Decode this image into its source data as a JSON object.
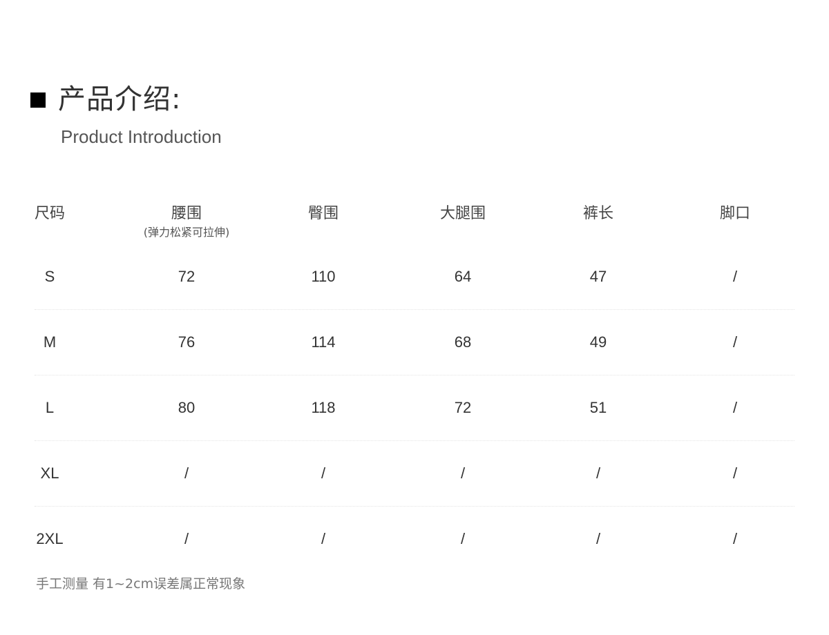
{
  "section": {
    "title": "产品介绍:",
    "subtitle": "Product Introduction"
  },
  "table": {
    "headers": [
      {
        "label": "尺码",
        "note": ""
      },
      {
        "label": "腰围",
        "note": "(弹力松紧可拉伸)"
      },
      {
        "label": "臀围",
        "note": ""
      },
      {
        "label": "大腿围",
        "note": ""
      },
      {
        "label": "裤长",
        "note": ""
      },
      {
        "label": "脚口",
        "note": ""
      }
    ],
    "rows": [
      [
        "S",
        "72",
        "110",
        "64",
        "47",
        "/"
      ],
      [
        "M",
        "76",
        "114",
        "68",
        "49",
        "/"
      ],
      [
        "L",
        "80",
        "118",
        "72",
        "51",
        "/"
      ],
      [
        "XL",
        "/",
        "/",
        "/",
        "/",
        "/"
      ],
      [
        "2XL",
        "/",
        "/",
        "/",
        "/",
        "/"
      ]
    ]
  },
  "footer": {
    "note": "手工测量 有1~2cm误差属正常现象"
  },
  "colors": {
    "marker": "#000000",
    "text": "#333333",
    "divider": "#e4e4e4"
  }
}
